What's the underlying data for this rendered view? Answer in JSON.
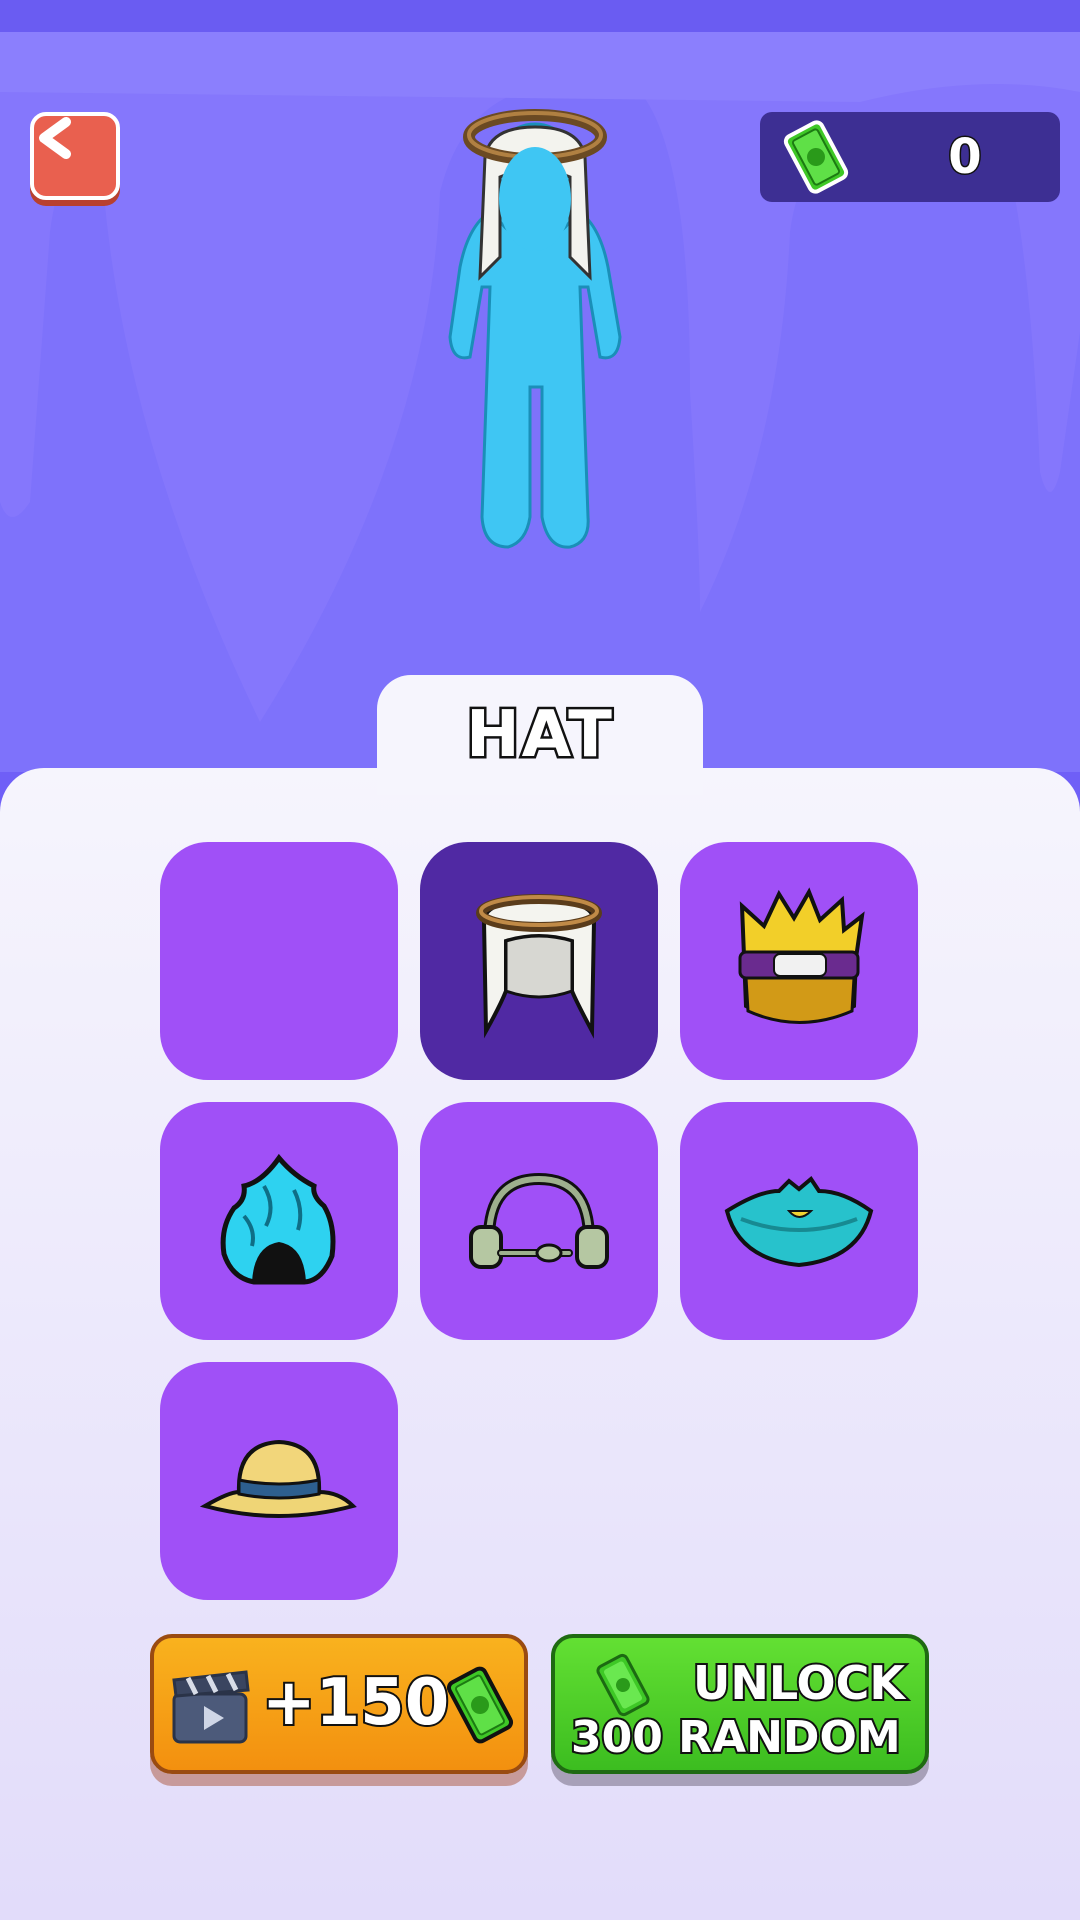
{
  "header": {
    "back_label": "<",
    "currency": {
      "icon": "cash-icon",
      "amount": "0"
    }
  },
  "category_tab": {
    "label": "HAT"
  },
  "items": [
    {
      "name": "none",
      "icon": "empty-slot",
      "selected": false
    },
    {
      "name": "keffiyeh",
      "icon": "keffiyeh-hat-icon",
      "selected": true
    },
    {
      "name": "spiky-blond-hair",
      "icon": "spiky-hair-headband-icon",
      "selected": false
    },
    {
      "name": "blue-flame-hair",
      "icon": "blue-flame-hair-icon",
      "selected": false
    },
    {
      "name": "headset",
      "icon": "headset-icon",
      "selected": false
    },
    {
      "name": "teal-tricorn",
      "icon": "tricorn-hat-icon",
      "selected": false
    },
    {
      "name": "straw-hat",
      "icon": "straw-hat-icon",
      "selected": false
    }
  ],
  "buttons": {
    "watch_ad": {
      "amount": "+150",
      "icon": "clapperboard-icon"
    },
    "unlock": {
      "line1": "UNLOCK",
      "line2": "300 RANDOM",
      "icon": "cash-icon"
    }
  },
  "colors": {
    "background": "#7e72fb",
    "item_bg": "#a050f7",
    "item_selected_bg": "#5029a3",
    "back_button": "#e9604f",
    "ad_button": "#f7a51a",
    "unlock_button": "#4ccd28",
    "character": "#3fc6f3"
  }
}
